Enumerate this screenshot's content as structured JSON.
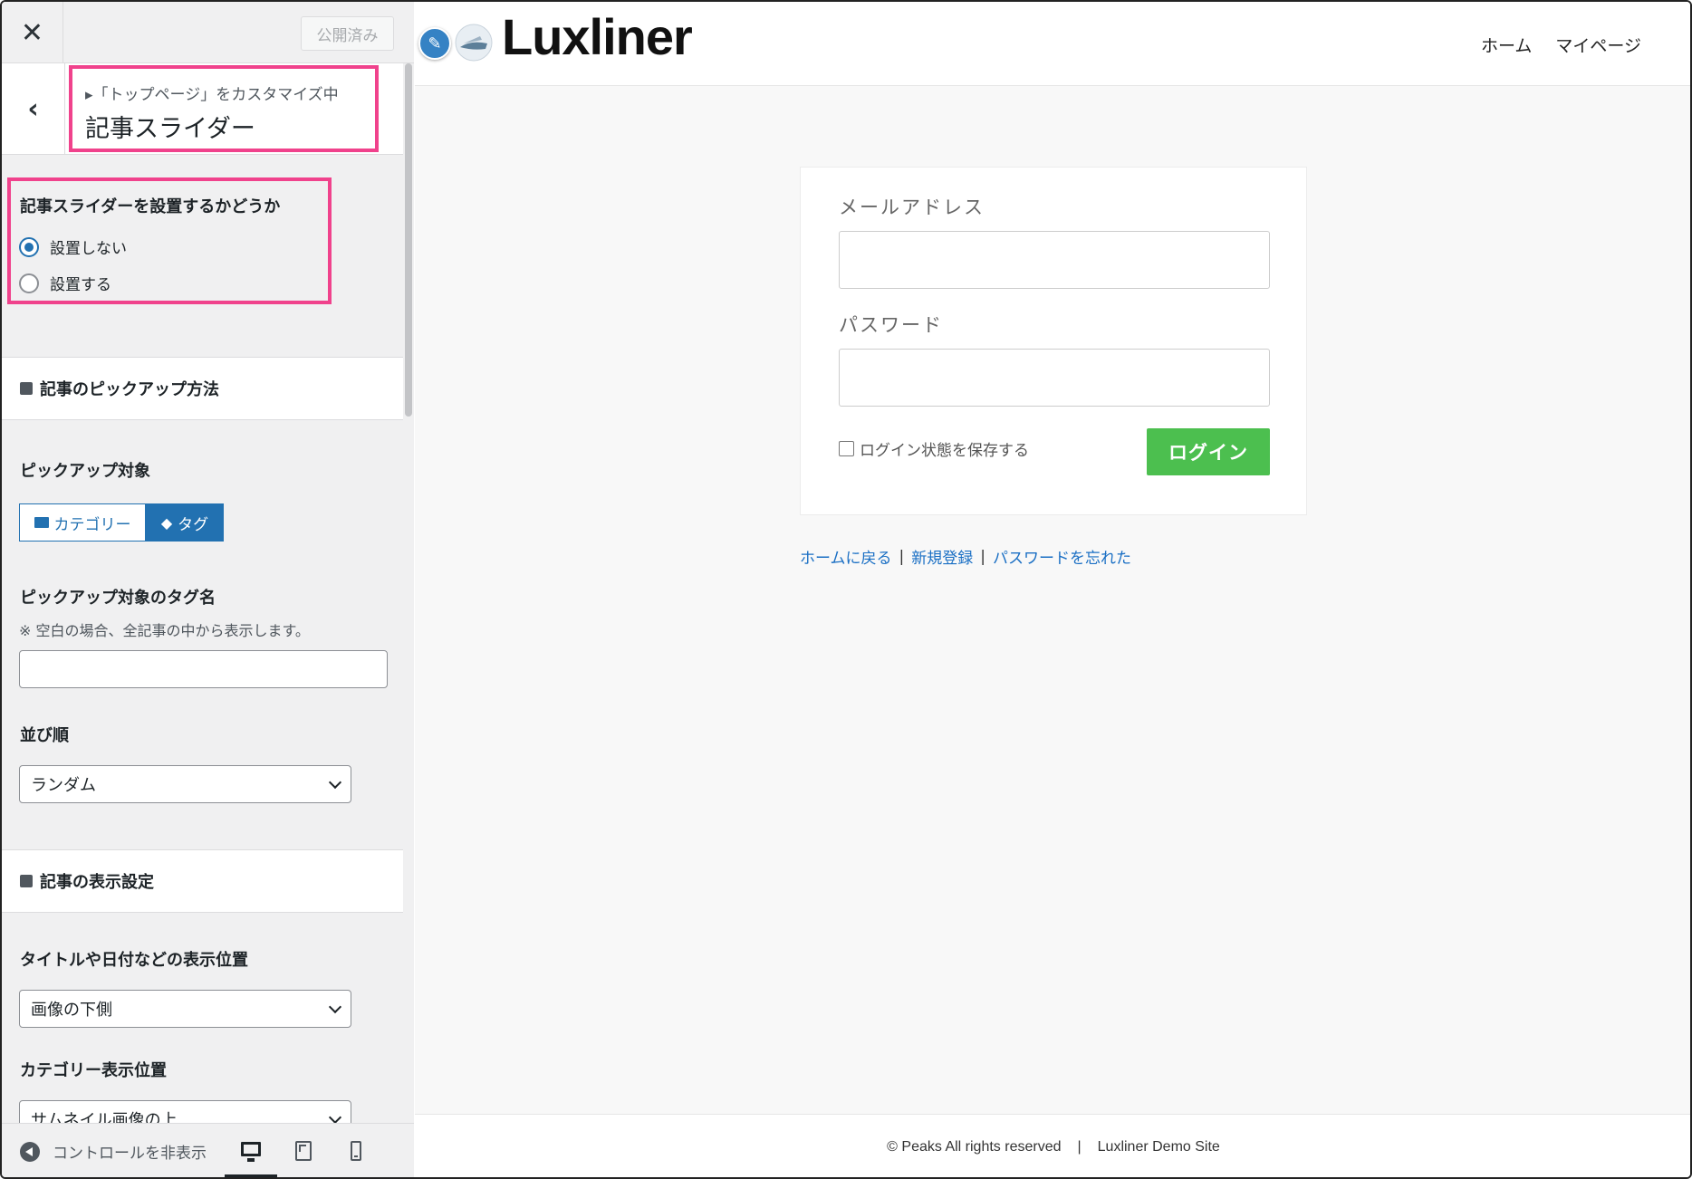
{
  "sidebar": {
    "close_icon": "close-icon",
    "publish_label": "公開済み",
    "breadcrumb": "▸「トップページ」をカスタマイズ中",
    "section_title": "記事スライダー",
    "slider_control": {
      "label": "記事スライダーを設置するかどうか",
      "options": [
        "設置しない",
        "設置する"
      ],
      "selected": "設置しない"
    },
    "pickup_group_title": "記事のピックアップ方法",
    "pickup_target_label": "ピックアップ対象",
    "pickup_options": [
      "カテゴリー",
      "タグ"
    ],
    "pickup_selected": "タグ",
    "tag_name_label": "ピックアップ対象のタグ名",
    "tag_name_note": "※ 空白の場合、全記事の中から表示します。",
    "tag_name_value": "",
    "order_label": "並び順",
    "order_value": "ランダム",
    "display_group_title": "記事の表示設定",
    "title_position_label": "タイトルや日付などの表示位置",
    "title_position_value": "画像の下側",
    "category_position_label": "カテゴリー表示位置",
    "category_position_value": "サムネイル画像の上",
    "hide_controls_label": "コントロールを非表示",
    "devices": [
      "desktop-icon",
      "tablet-icon",
      "mobile-icon"
    ],
    "active_device": "desktop"
  },
  "preview": {
    "logo_text": "Luxliner",
    "nav": [
      "ホーム",
      "マイページ"
    ],
    "email_label": "メールアドレス",
    "email_value": "",
    "password_label": "パスワード",
    "password_value": "",
    "remember_label": "ログイン状態を保存する",
    "login_button": "ログイン",
    "links": [
      "ホームに戻る",
      "新規登録",
      "パスワードを忘れた"
    ],
    "link_separator": "|",
    "footer_copyright": "© Peaks All rights reserved",
    "footer_separator": "|",
    "footer_site": "Luxliner Demo Site"
  },
  "colors": {
    "highlight": "#f0428c",
    "accent": "#2271b1",
    "login_green": "#4cbf4f",
    "link_blue": "#1a6fc4"
  }
}
